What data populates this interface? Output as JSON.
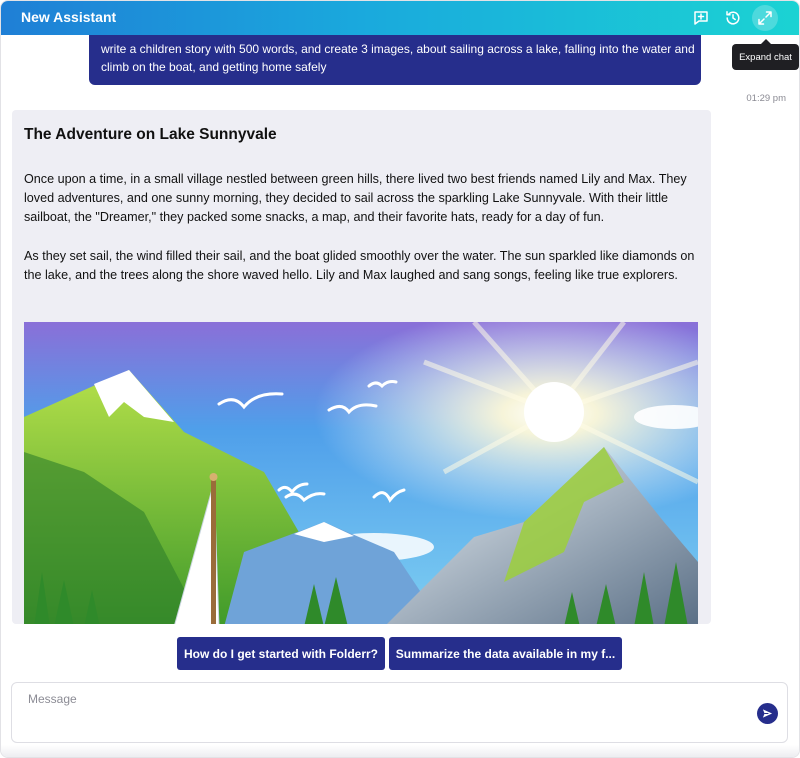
{
  "header": {
    "title": "New Assistant",
    "icons": [
      "new-chat-icon",
      "history-icon",
      "expand-icon"
    ],
    "tooltip": "Expand chat"
  },
  "messages": {
    "user": {
      "text": "write a children story with 500 words, and create 3 images, about sailing across a lake, falling into the water and climb on the boat, and getting home safely",
      "time": "01:29 pm"
    },
    "assistant": {
      "title": "The Adventure on Lake Sunnyvale",
      "paragraphs": [
        "Once upon a time, in a small village nestled between green hills, there lived two best friends named Lily and Max. They loved adventures, and one sunny morning, they decided to sail across the sparkling Lake Sunnyvale. With their little sailboat, the \"Dreamer,\" they packed some snacks, a map, and their favorite hats, ready for a day of fun.",
        "As they set sail, the wind filled their sail, and the boat glided smoothly over the water. The sun sparkled like diamonds on the lake, and the trees along the shore waved hello. Lily and Max laughed and sang songs, feeling like true explorers."
      ]
    }
  },
  "suggestions": [
    "How do I get started with Folderr?",
    "Summarize the data available in my f..."
  ],
  "composer": {
    "placeholder": "Message",
    "send_icon": "send-icon"
  },
  "colors": {
    "header_gradient": [
      "#1f7fd6",
      "#1bd3d3"
    ],
    "user_bubble": "#262e8c",
    "assistant_bubble": "#eeeef4",
    "suggestion_button": "#262e8c"
  }
}
